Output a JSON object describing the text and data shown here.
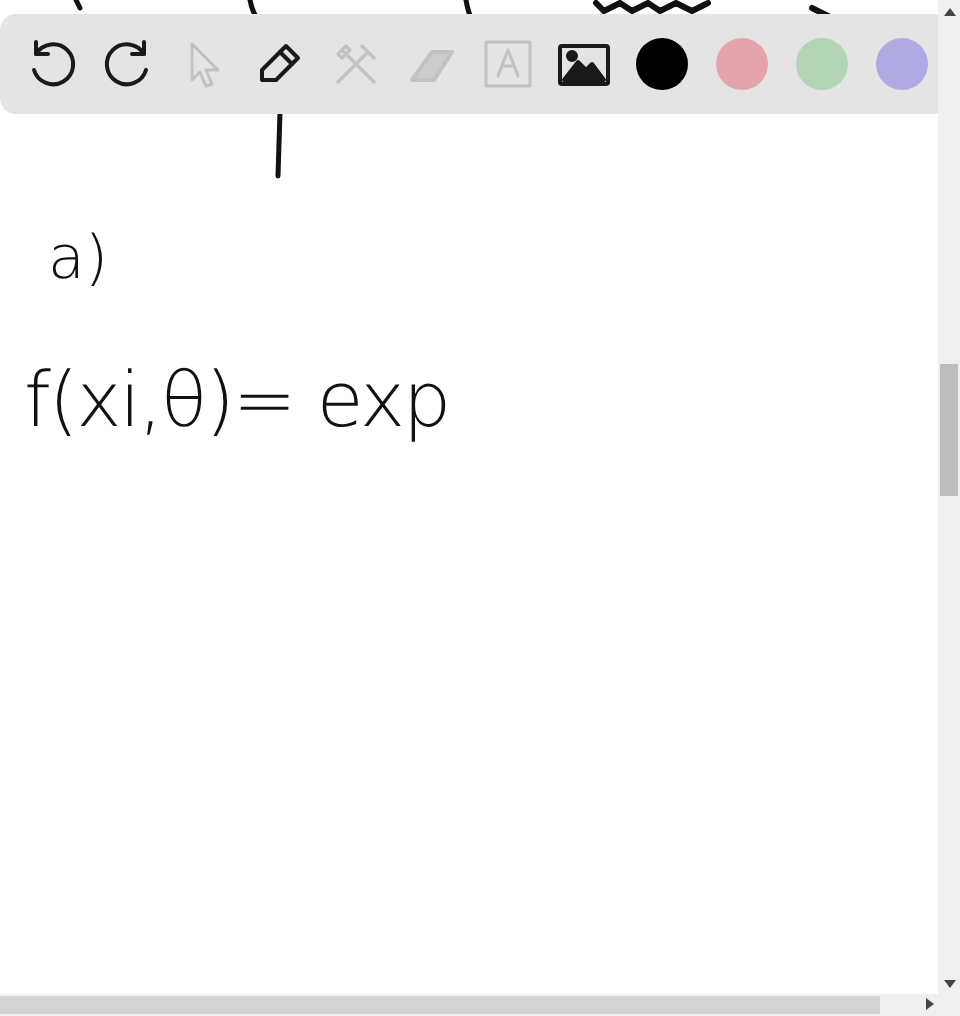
{
  "toolbar": {
    "tools": [
      {
        "kind": "undo",
        "disabled": false
      },
      {
        "kind": "redo",
        "disabled": false
      },
      {
        "kind": "select",
        "disabled": true
      },
      {
        "kind": "pen",
        "disabled": false
      },
      {
        "kind": "tools",
        "disabled": true
      },
      {
        "kind": "eraser",
        "disabled": true
      },
      {
        "kind": "text",
        "disabled": true
      },
      {
        "kind": "image",
        "disabled": false
      }
    ],
    "colors": [
      {
        "color": "#000000"
      },
      {
        "color": "#e5a3ac"
      },
      {
        "color": "#b3d4b5"
      },
      {
        "color": "#aeabe3"
      }
    ]
  },
  "canvas": {
    "handwriting": [
      {
        "kind": "label",
        "text": "a)"
      },
      {
        "kind": "formula",
        "text": "f(xi,θ)= exp"
      }
    ]
  }
}
